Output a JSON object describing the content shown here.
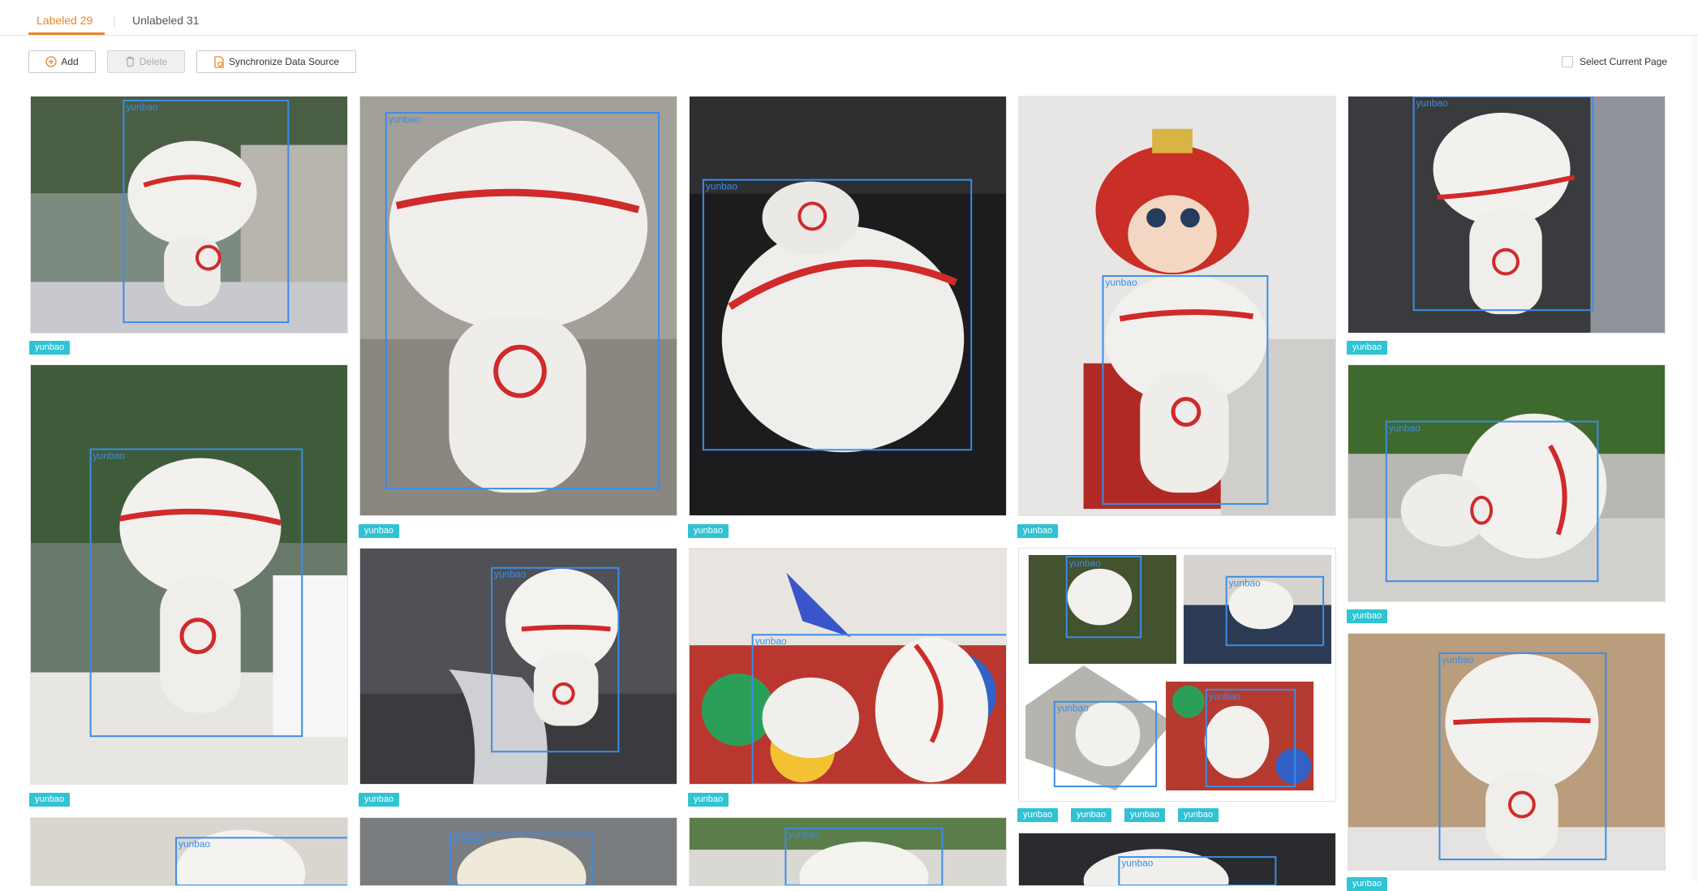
{
  "tabs": [
    {
      "label": "Labeled 29"
    },
    {
      "label": "Unlabeled 31"
    }
  ],
  "toolbar": {
    "add_label": "Add",
    "delete_label": "Delete",
    "sync_label": "Synchronize Data Source",
    "select_page_label": "Select Current Page",
    "select_page_checked": false
  },
  "gallery": {
    "tag_color": "#2fc3d3",
    "bbox_color": "#3c8ce7",
    "items": [
      {
        "tags": [
          "yunbao"
        ],
        "box_label": "yunbao"
      },
      {
        "tags": [
          "yunbao"
        ],
        "box_label": "yunbao"
      },
      {
        "tags": [
          "yunbao"
        ],
        "box_label": "yunbao"
      },
      {
        "tags": [
          "yunbao"
        ],
        "box_label": "yunbao"
      },
      {
        "tags": [
          "yunbao"
        ],
        "box_label": "yunbao"
      },
      {
        "tags": [
          "yunbao"
        ],
        "box_label": "yunbao"
      },
      {
        "tags": [
          "yunbao"
        ],
        "box_label": "yunbao"
      },
      {
        "tags": [
          "yunbao"
        ],
        "box_label": "yunbao"
      },
      {
        "tags": [
          "yunbao",
          "yunbao",
          "yunbao",
          "yunbao"
        ],
        "box_label": "yunbao"
      },
      {
        "tags": [
          "yunbao"
        ],
        "box_label": "yunbao"
      },
      {
        "tags": [
          "yunbao"
        ],
        "box_label": "yunbao"
      },
      {
        "tags": [],
        "box_label": "yunbao"
      },
      {
        "tags": [],
        "box_label": "yunbao"
      },
      {
        "tags": [],
        "box_label": "yunbao"
      },
      {
        "tags": [],
        "box_label": "yunbao"
      }
    ]
  }
}
